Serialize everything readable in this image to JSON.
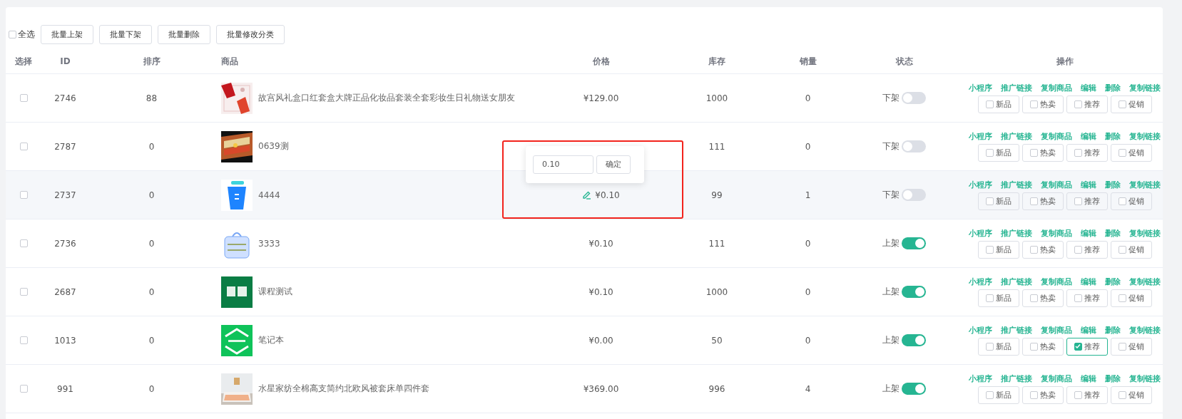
{
  "toolbar": {
    "select_all": {
      "label": "全选",
      "checked": false
    },
    "buttons": [
      "批量上架",
      "批量下架",
      "批量删除",
      "批量修改分类"
    ]
  },
  "columns": [
    "选择",
    "ID",
    "排序",
    "商品",
    "价格",
    "库存",
    "销量",
    "状态",
    "操作"
  ],
  "price_editor": {
    "value": "0.10",
    "button": "确定",
    "highlighted": true
  },
  "rows": [
    {
      "selected": false,
      "hover": false,
      "editing": false,
      "id": "2746",
      "sort": "88",
      "name": "故宫风礼盒口红套盒大牌正品化妆品套装全套彩妆生日礼物送女朋友",
      "picture": {
        "kind": "picture"
      },
      "price": "¥129.00",
      "stock": "1000",
      "sales": "0",
      "status": "下架",
      "on": false,
      "actions": [
        "小程序",
        "推广链接",
        "复制商品",
        "编辑",
        "删除",
        "复制链接"
      ],
      "tags": [
        {
          "label": "新品",
          "checked": false
        },
        {
          "label": "热卖",
          "checked": false
        },
        {
          "label": "推荐",
          "checked": false
        },
        {
          "label": "促销",
          "checked": false
        }
      ]
    },
    {
      "selected": false,
      "hover": false,
      "editing": false,
      "id": "2787",
      "sort": "0",
      "name": "0639测",
      "picture": {
        "kind": "picture"
      },
      "stock": "111",
      "sales": "0",
      "status": "下架",
      "on": false,
      "actions": [
        "小程序",
        "推广链接",
        "复制商品",
        "编辑",
        "删除",
        "复制链接"
      ],
      "tags": [
        {
          "label": "新品",
          "checked": false
        },
        {
          "label": "热卖",
          "checked": false
        },
        {
          "label": "推荐",
          "checked": false
        },
        {
          "label": "促销",
          "checked": false
        }
      ]
    },
    {
      "selected": false,
      "hover": true,
      "editing": true,
      "id": "2737",
      "sort": "0",
      "name": "4444",
      "picture": {
        "kind": "picture"
      },
      "price": "¥0.10",
      "stock": "99",
      "sales": "1",
      "status": "下架",
      "on": false,
      "actions": [
        "小程序",
        "推广链接",
        "复制商品",
        "编辑",
        "删除",
        "复制链接"
      ],
      "tags": [
        {
          "label": "新品",
          "checked": false
        },
        {
          "label": "热卖",
          "checked": false
        },
        {
          "label": "推荐",
          "checked": false
        },
        {
          "label": "促销",
          "checked": false
        }
      ]
    },
    {
      "selected": false,
      "hover": false,
      "editing": false,
      "id": "2736",
      "sort": "0",
      "name": "3333",
      "picture": {
        "kind": "picture"
      },
      "price": "¥0.10",
      "stock": "111",
      "sales": "0",
      "status": "上架",
      "on": true,
      "actions": [
        "小程序",
        "推广链接",
        "复制商品",
        "编辑",
        "删除",
        "复制链接"
      ],
      "tags": [
        {
          "label": "新品",
          "checked": false
        },
        {
          "label": "热卖",
          "checked": false
        },
        {
          "label": "推荐",
          "checked": false
        },
        {
          "label": "促销",
          "checked": false
        }
      ]
    },
    {
      "selected": false,
      "hover": false,
      "editing": false,
      "id": "2687",
      "sort": "0",
      "name": "课程测试",
      "picture": {
        "kind": "picture"
      },
      "price": "¥0.10",
      "stock": "1000",
      "sales": "0",
      "status": "上架",
      "on": true,
      "actions": [
        "小程序",
        "推广链接",
        "复制商品",
        "编辑",
        "删除",
        "复制链接"
      ],
      "tags": [
        {
          "label": "新品",
          "checked": false
        },
        {
          "label": "热卖",
          "checked": false
        },
        {
          "label": "推荐",
          "checked": false
        },
        {
          "label": "促销",
          "checked": false
        }
      ]
    },
    {
      "selected": false,
      "hover": false,
      "editing": false,
      "id": "1013",
      "sort": "0",
      "name": "笔记本",
      "picture": {
        "kind": "picture"
      },
      "price": "¥0.00",
      "stock": "50",
      "sales": "0",
      "status": "上架",
      "on": true,
      "actions": [
        "小程序",
        "推广链接",
        "复制商品",
        "编辑",
        "删除",
        "复制链接"
      ],
      "tags": [
        {
          "label": "新品",
          "checked": false
        },
        {
          "label": "热卖",
          "checked": false
        },
        {
          "label": "推荐",
          "checked": true
        },
        {
          "label": "促销",
          "checked": false
        }
      ]
    },
    {
      "selected": false,
      "hover": false,
      "editing": false,
      "id": "991",
      "sort": "0",
      "name": "水星家纺全棉高支简约北欧风被套床单四件套",
      "picture": {
        "kind": "picture"
      },
      "price": "¥369.00",
      "stock": "996",
      "sales": "4",
      "status": "上架",
      "on": true,
      "actions": [
        "小程序",
        "推广链接",
        "复制商品",
        "编辑",
        "删除",
        "复制链接"
      ],
      "tags": [
        {
          "label": "新品",
          "checked": false
        },
        {
          "label": "热卖",
          "checked": false
        },
        {
          "label": "推荐",
          "checked": false
        },
        {
          "label": "促销",
          "checked": false
        }
      ]
    }
  ]
}
